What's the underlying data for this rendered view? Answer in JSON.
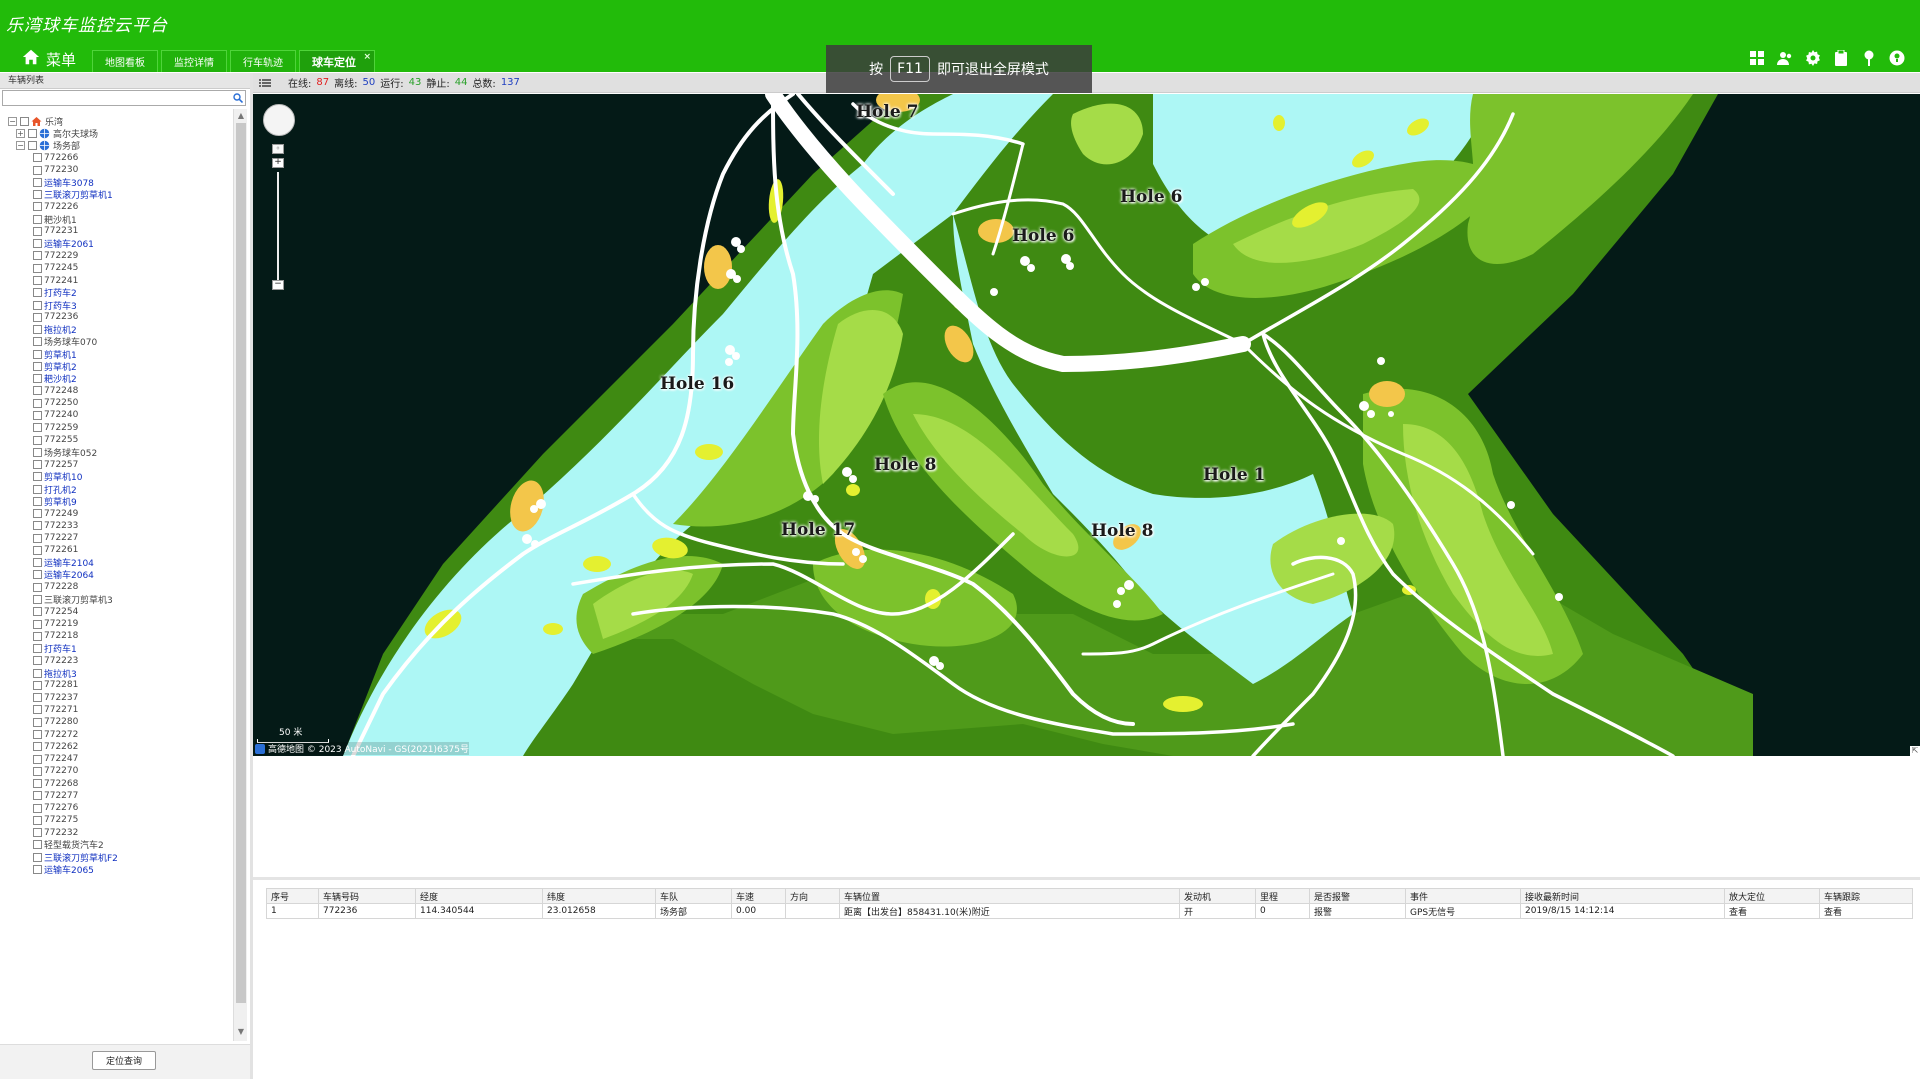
{
  "header": {
    "title": "乐湾球车监控云平台",
    "menu_label": "菜单",
    "tabs": [
      {
        "label": "地图看板"
      },
      {
        "label": "监控详情"
      },
      {
        "label": "行车轨迹"
      },
      {
        "label": "球车定位",
        "active": true,
        "close": "×"
      }
    ],
    "icons": [
      "dashboard-icon",
      "user-group-icon",
      "settings-icon",
      "clipboard-icon",
      "pin-icon",
      "help-icon"
    ]
  },
  "fullscreen_hint": {
    "prefix": "按",
    "key": "F11",
    "suffix": "即可退出全屏模式"
  },
  "sidebar": {
    "title": "车辆列表",
    "search_placeholder": "",
    "locate_button": "定位查询",
    "tree": [
      {
        "label": "乐湾",
        "level": 0,
        "expander": "⊟",
        "icon": "house-icon"
      },
      {
        "label": "高尔夫球场",
        "level": 1,
        "expander": "⊞",
        "icon": "globe-icon"
      },
      {
        "label": "场务部",
        "level": 1,
        "expander": "⊟",
        "icon": "globe-icon"
      },
      {
        "label": "772266",
        "level": 2
      },
      {
        "label": "772230",
        "level": 2
      },
      {
        "label": "运输车3078",
        "level": 2,
        "blue": true
      },
      {
        "label": "三联滚刀剪草机1",
        "level": 2,
        "blue": true
      },
      {
        "label": "772226",
        "level": 2
      },
      {
        "label": "耙沙机1",
        "level": 2
      },
      {
        "label": "772231",
        "level": 2
      },
      {
        "label": "运输车2061",
        "level": 2,
        "blue": true
      },
      {
        "label": "772229",
        "level": 2
      },
      {
        "label": "772245",
        "level": 2
      },
      {
        "label": "772241",
        "level": 2
      },
      {
        "label": "打药车2",
        "level": 2,
        "blue": true
      },
      {
        "label": "打药车3",
        "level": 2,
        "blue": true
      },
      {
        "label": "772236",
        "level": 2
      },
      {
        "label": "拖拉机2",
        "level": 2,
        "blue": true
      },
      {
        "label": "场务球车070",
        "level": 2
      },
      {
        "label": "剪草机1",
        "level": 2,
        "blue": true
      },
      {
        "label": "剪草机2",
        "level": 2,
        "blue": true
      },
      {
        "label": "耙沙机2",
        "level": 2,
        "blue": true
      },
      {
        "label": "772248",
        "level": 2
      },
      {
        "label": "772250",
        "level": 2
      },
      {
        "label": "772240",
        "level": 2
      },
      {
        "label": "772259",
        "level": 2
      },
      {
        "label": "772255",
        "level": 2
      },
      {
        "label": "场务球车052",
        "level": 2
      },
      {
        "label": "772257",
        "level": 2
      },
      {
        "label": "剪草机10",
        "level": 2,
        "blue": true
      },
      {
        "label": "打孔机2",
        "level": 2,
        "blue": true
      },
      {
        "label": "剪草机9",
        "level": 2,
        "blue": true
      },
      {
        "label": "772249",
        "level": 2
      },
      {
        "label": "772233",
        "level": 2
      },
      {
        "label": "772227",
        "level": 2
      },
      {
        "label": "772261",
        "level": 2
      },
      {
        "label": "运输车2104",
        "level": 2,
        "blue": true
      },
      {
        "label": "运输车2064",
        "level": 2,
        "blue": true
      },
      {
        "label": "772228",
        "level": 2
      },
      {
        "label": "三联滚刀剪草机3",
        "level": 2
      },
      {
        "label": "772254",
        "level": 2
      },
      {
        "label": "772219",
        "level": 2
      },
      {
        "label": "772218",
        "level": 2
      },
      {
        "label": "打药车1",
        "level": 2,
        "blue": true
      },
      {
        "label": "772223",
        "level": 2
      },
      {
        "label": "拖拉机3",
        "level": 2,
        "blue": true
      },
      {
        "label": "772281",
        "level": 2
      },
      {
        "label": "772237",
        "level": 2
      },
      {
        "label": "772271",
        "level": 2
      },
      {
        "label": "772280",
        "level": 2
      },
      {
        "label": "772272",
        "level": 2
      },
      {
        "label": "772262",
        "level": 2
      },
      {
        "label": "772247",
        "level": 2
      },
      {
        "label": "772270",
        "level": 2
      },
      {
        "label": "772268",
        "level": 2
      },
      {
        "label": "772277",
        "level": 2
      },
      {
        "label": "772276",
        "level": 2
      },
      {
        "label": "772275",
        "level": 2
      },
      {
        "label": "772232",
        "level": 2
      },
      {
        "label": "轻型载货汽车2",
        "level": 2
      },
      {
        "label": "三联滚刀剪草机F2",
        "level": 2,
        "blue": true
      },
      {
        "label": "运输车2065",
        "level": 2,
        "blue": true
      }
    ]
  },
  "status_bar": {
    "online_label": "在线:",
    "online": "87",
    "offline_label": "离线:",
    "offline": "50",
    "running_label": "运行:",
    "running": "43",
    "idle_label": "静止:",
    "idle": "44",
    "total_label": "总数:",
    "total": "137",
    "colors": {
      "online": "#e02020",
      "offline": "#2040c0",
      "running": "#28a028",
      "idle": "#28a028",
      "total": "#2040c0"
    }
  },
  "map": {
    "hole_labels": [
      "Hole 7",
      "Hole 6",
      "Hole 6",
      "Hole 16",
      "Hole 8",
      "Hole 1",
      "Hole 17",
      "Hole 8"
    ],
    "scale_label": "50 米",
    "attribution": "高德地图 © 2023 AutoNavi - GS(2021)6375号",
    "colors": {
      "water": "#adf7f5",
      "rough": "#3f8a12",
      "fairway": "#7cc22c",
      "light": "#a5dc48",
      "sand": "#f3c64a",
      "tee": "#e4f030",
      "background": "#041a17"
    }
  },
  "table": {
    "columns": [
      "序号",
      "车辆号码",
      "经度",
      "纬度",
      "车队",
      "车速",
      "方向",
      "车辆位置",
      "发动机",
      "里程",
      "是否报警",
      "事件",
      "接收最新时间",
      "放大定位",
      "车辆跟踪"
    ],
    "rows": [
      [
        "1",
        "772236",
        "114.340544",
        "23.012658",
        "场务部",
        "0.00",
        "",
        "距离【出发台】858431.10(米)附近",
        "开",
        "0",
        "报警",
        "GPS无信号",
        "2019/8/15 14:12:14",
        "查看",
        "查看"
      ]
    ]
  }
}
